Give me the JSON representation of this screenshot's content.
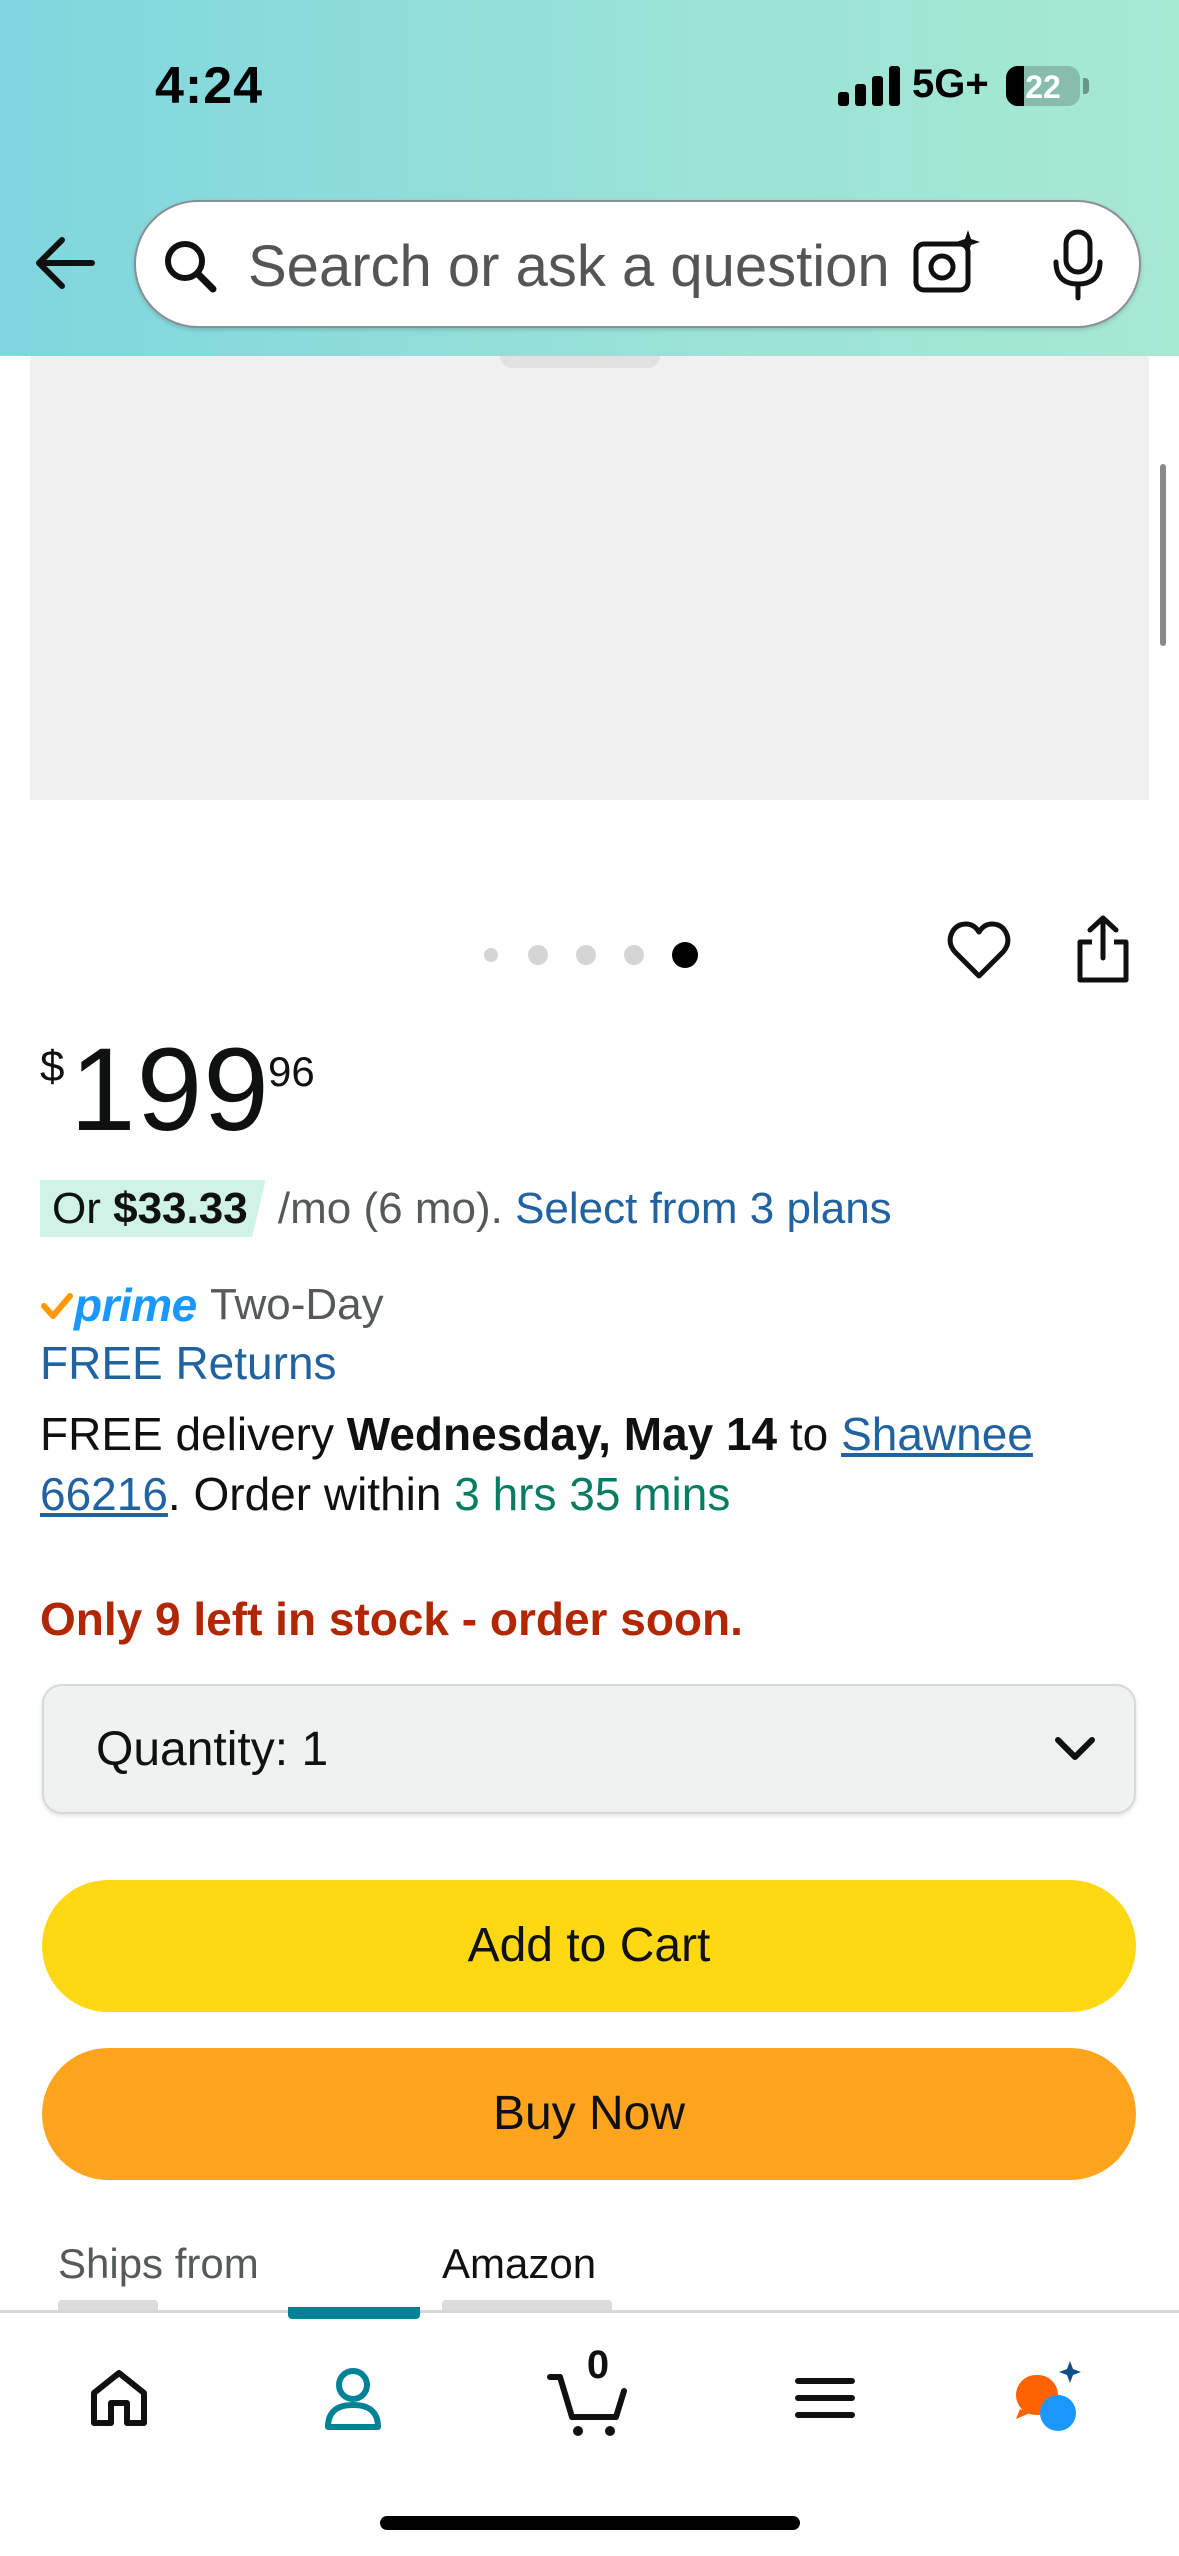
{
  "status_bar": {
    "time": "4:24",
    "network": "5G+",
    "battery": "22"
  },
  "search": {
    "placeholder": "Search or ask a question"
  },
  "carousel": {
    "dot_count": 5,
    "active_index": 4
  },
  "product": {
    "price_symbol": "$",
    "price_whole": "199",
    "price_fraction": "96",
    "installment_prefix": "Or ",
    "installment_amount": "$33.33",
    "installment_suffix": " /mo (6 mo). ",
    "installment_link": "Select from 3 plans",
    "prime_label": "prime",
    "prime_speed": "Two-Day",
    "returns": "FREE Returns",
    "delivery_prefix": "FREE delivery ",
    "delivery_date": "Wednesday, May 14",
    "delivery_to": " to ",
    "delivery_location": "Shawnee 66216",
    "order_within_prefix": ". Order within ",
    "order_within_time": "3 hrs 35 mins",
    "stock_message": "Only 9 left in stock - order soon."
  },
  "quantity": {
    "label": "Quantity:",
    "value": "1"
  },
  "buttons": {
    "add_to_cart": "Add to Cart",
    "buy_now": "Buy Now"
  },
  "shipping": {
    "ships_from_label": "Ships from",
    "ships_from_value": "Amazon"
  },
  "bottom_nav": {
    "cart_count": "0",
    "active_tab": "account",
    "items": [
      "home-icon",
      "account-icon",
      "cart-icon",
      "menu-icon",
      "rufus-icon"
    ]
  },
  "colors": {
    "add_to_cart": "#ffd814",
    "buy_now": "#ffa41c",
    "link": "#2162a1",
    "stock_warning": "#b12704",
    "countdown": "#067d62",
    "nav_active": "#008296"
  }
}
